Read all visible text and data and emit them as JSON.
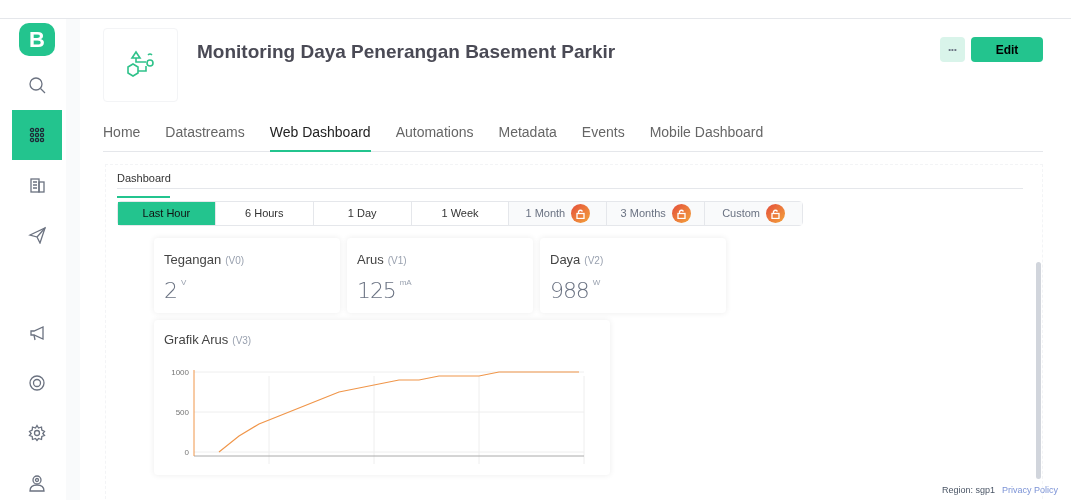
{
  "sidebar": {
    "logo": "B",
    "items": [
      {
        "selected": false
      },
      {
        "selected": true
      },
      {
        "selected": false
      },
      {
        "selected": false
      }
    ],
    "bottom_items": [
      {
        "selected": false
      },
      {
        "selected": false
      },
      {
        "selected": false
      },
      {
        "selected": false
      }
    ]
  },
  "header": {
    "title": "Monitoring Daya Penerangan Basement Parkir",
    "more_button": "•••",
    "edit_button": "Edit"
  },
  "tabs": [
    {
      "label": "Home",
      "selected": false
    },
    {
      "label": "Datastreams",
      "selected": false
    },
    {
      "label": "Web Dashboard",
      "selected": true
    },
    {
      "label": "Automations",
      "selected": false
    },
    {
      "label": "Metadata",
      "selected": false
    },
    {
      "label": "Events",
      "selected": false
    },
    {
      "label": "Mobile Dashboard",
      "selected": false
    }
  ],
  "dashboard_tab": {
    "label": "Dashboard",
    "selected": true
  },
  "time_ranges": [
    {
      "label": "Last Hour",
      "selected": true,
      "locked": false
    },
    {
      "label": "6 Hours",
      "selected": false,
      "locked": false
    },
    {
      "label": "1 Day",
      "selected": false,
      "locked": false
    },
    {
      "label": "1 Week",
      "selected": false,
      "locked": false
    },
    {
      "label": "1 Month",
      "selected": false,
      "locked": true
    },
    {
      "label": "3 Months",
      "selected": false,
      "locked": true
    },
    {
      "label": "Custom",
      "selected": false,
      "locked": true
    }
  ],
  "widgets": [
    {
      "title": "Tegangan",
      "pin": "(V0)",
      "value": "2",
      "unit": "V"
    },
    {
      "title": "Arus",
      "pin": "(V1)",
      "value": "125",
      "unit": "mA"
    },
    {
      "title": "Daya",
      "pin": "(V2)",
      "value": "988",
      "unit": "W"
    }
  ],
  "chart_widget": {
    "title": "Grafik Arus",
    "pin": "(V3)",
    "chart_data": {
      "type": "line",
      "ylim": [
        0,
        1000
      ],
      "yticks": [
        0,
        500,
        1000
      ],
      "values": [
        0,
        200,
        350,
        450,
        550,
        650,
        750,
        800,
        850,
        900,
        900,
        950,
        950,
        950,
        1000,
        1000,
        1000,
        1000,
        1000
      ]
    }
  },
  "footer": {
    "region": "Region: sgp1",
    "privacy_link": "Privacy Policy"
  }
}
